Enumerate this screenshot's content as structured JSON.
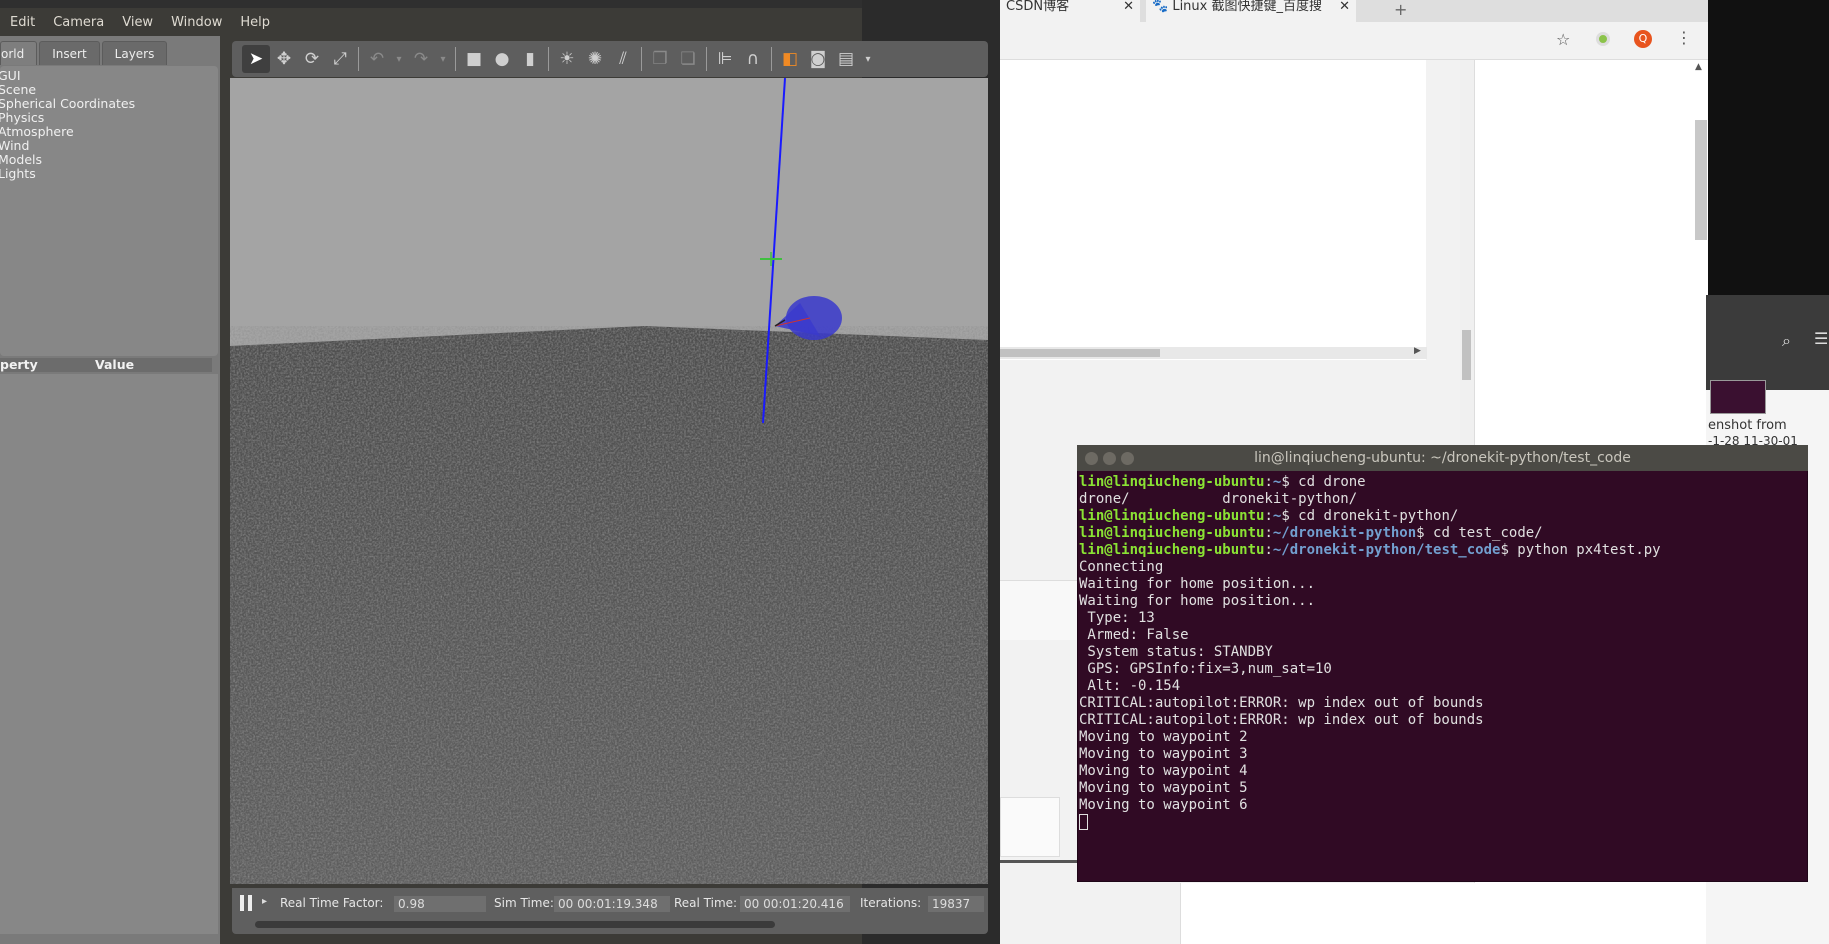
{
  "gazebo": {
    "menu": [
      "Edit",
      "Camera",
      "View",
      "Window",
      "Help"
    ],
    "tabs": [
      "orld",
      "Insert",
      "Layers"
    ],
    "world_items": [
      "GUI",
      "Scene",
      "Spherical Coordinates",
      "Physics",
      "Atmosphere",
      "Wind",
      "Models",
      "Lights"
    ],
    "prop_header": {
      "property": "perty",
      "value": "Value"
    },
    "status": {
      "rtf_label": "Real Time Factor:",
      "rtf": "0.98",
      "sim_label": "Sim Time:",
      "sim": "00 00:01:19.348",
      "real_label": "Real Time:",
      "real": "00 00:01:20.416",
      "iter_label": "Iterations:",
      "iter": "19837"
    }
  },
  "chrome": {
    "tab1": "CSDN博客",
    "tab2": "Linux 截图快捷键_百度搜",
    "profile_initial": "Q"
  },
  "files": {
    "thumb_label1": "enshot from",
    "thumb_label2": "-1-28 11-30-01"
  },
  "terminal": {
    "title": "lin@linqiucheng-ubuntu: ~/dronekit-python/test_code",
    "lines": [
      {
        "user": "lin@linqiucheng-ubuntu",
        "path": "~",
        "cmd": "$ cd drone"
      },
      {
        "text": "drone/           dronekit-python/"
      },
      {
        "user": "lin@linqiucheng-ubuntu",
        "path": "~",
        "cmd": "$ cd dronekit-python/"
      },
      {
        "user": "lin@linqiucheng-ubuntu",
        "path": "~/dronekit-python",
        "cmd": "$ cd test_code/"
      },
      {
        "user": "lin@linqiucheng-ubuntu",
        "path": "~/dronekit-python/test_code",
        "cmd": "$ python px4test.py"
      },
      {
        "text": "Connecting"
      },
      {
        "text": "Waiting for home position..."
      },
      {
        "text": "Waiting for home position..."
      },
      {
        "text": " Type: 13"
      },
      {
        "text": " Armed: False"
      },
      {
        "text": " System status: STANDBY"
      },
      {
        "text": " GPS: GPSInfo:fix=3,num_sat=10"
      },
      {
        "text": " Alt: -0.154"
      },
      {
        "text": "CRITICAL:autopilot:ERROR: wp index out of bounds"
      },
      {
        "text": "CRITICAL:autopilot:ERROR: wp index out of bounds"
      },
      {
        "text": "Moving to waypoint 2"
      },
      {
        "text": "Moving to waypoint 3"
      },
      {
        "text": "Moving to waypoint 4"
      },
      {
        "text": "Moving to waypoint 5"
      },
      {
        "text": "Moving to waypoint 6"
      }
    ]
  }
}
